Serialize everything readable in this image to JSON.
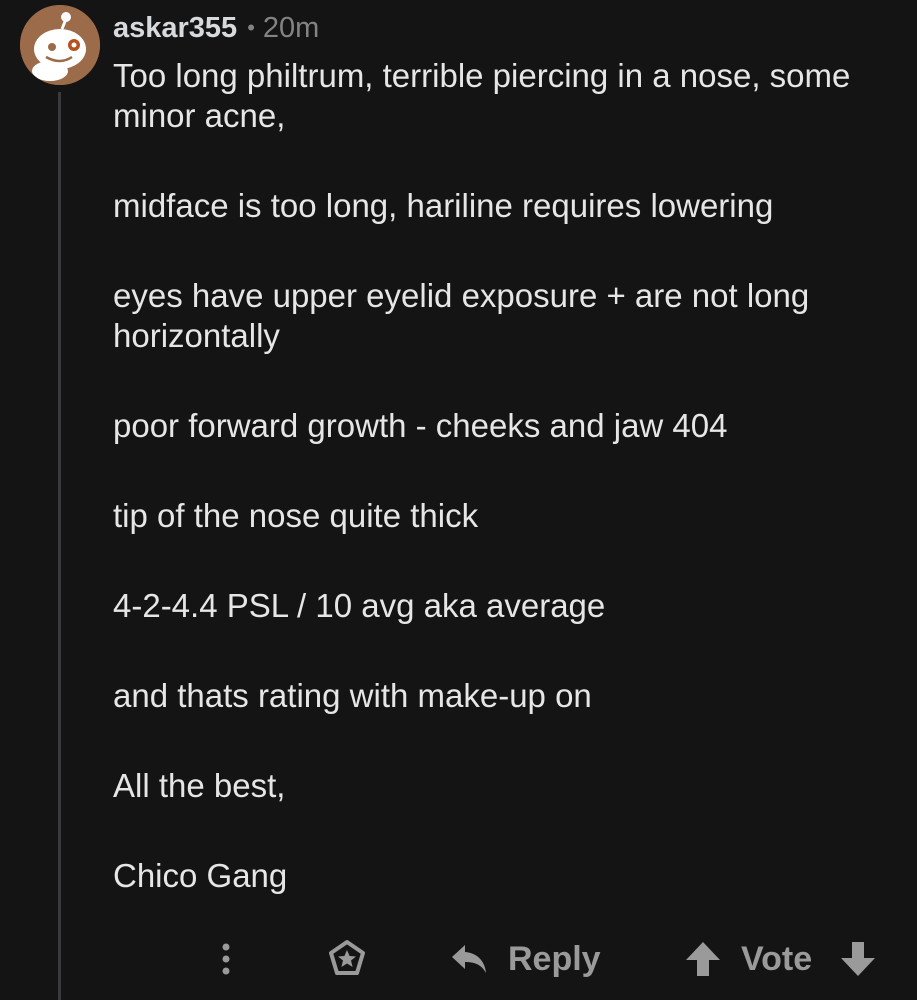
{
  "comment": {
    "author": "askar355",
    "separator": "•",
    "time_ago": "20m",
    "avatar_icon": "snoo-avatar-icon",
    "paragraphs": [
      "Too long philtrum, terrible piercing in a nose, some minor acne,",
      "midface is too long, hariline requires lowering",
      "eyes have upper eyelid exposure + are not long horizontally",
      "poor forward growth - cheeks and jaw 404",
      "tip of the nose quite thick",
      "4-2-4.4 PSL / 10 avg aka average",
      "and thats rating with make-up on",
      "All the best,",
      "Chico Gang"
    ]
  },
  "actions": {
    "more_icon": "more-vertical-icon",
    "award_icon": "award-icon",
    "reply_icon": "reply-arrow-icon",
    "reply_label": "Reply",
    "upvote_icon": "upvote-arrow-icon",
    "vote_label": "Vote",
    "downvote_icon": "downvote-arrow-icon"
  },
  "colors": {
    "background": "#141414",
    "text": "#e6e6e6",
    "muted": "#818384",
    "action": "#9a9a9a",
    "avatar_bg": "#9b6b4a"
  }
}
